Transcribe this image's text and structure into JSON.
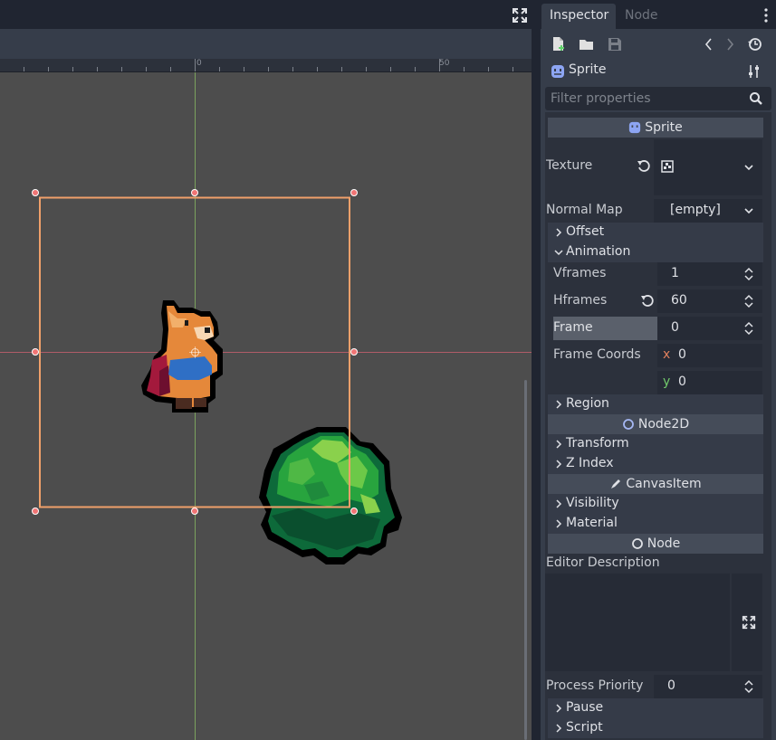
{
  "viewport": {
    "ruler_labels": [
      "0",
      "50"
    ]
  },
  "inspector": {
    "tabs": [
      "Inspector",
      "Node"
    ],
    "object_name": "Sprite",
    "filter_placeholder": "Filter properties",
    "sections": {
      "sprite": "Sprite",
      "node2d": "Node2D",
      "canvas_item": "CanvasItem",
      "node": "Node"
    },
    "properties": {
      "texture_label": "Texture",
      "normal_map_label": "Normal Map",
      "normal_map_value": "[empty]",
      "offset": "Offset",
      "animation": "Animation",
      "vframes_label": "Vframes",
      "vframes_value": "1",
      "hframes_label": "Hframes",
      "hframes_value": "60",
      "frame_label": "Frame",
      "frame_value": "0",
      "frame_coords_label": "Frame Coords",
      "frame_coords_x_axis": "x",
      "frame_coords_x": "0",
      "frame_coords_y_axis": "y",
      "frame_coords_y": "0",
      "region": "Region",
      "transform": "Transform",
      "z_index": "Z Index",
      "visibility": "Visibility",
      "material": "Material",
      "editor_description_label": "Editor Description",
      "process_priority_label": "Process Priority",
      "process_priority_value": "0",
      "pause": "Pause",
      "script": "Script"
    }
  },
  "colors": {
    "selection": "#f0a06a",
    "x_axis": "#c9606f",
    "y_axis": "#8fc764",
    "accent_blue": "#8da5f3",
    "x_label": "#e0805e",
    "y_label": "#71c96b"
  }
}
